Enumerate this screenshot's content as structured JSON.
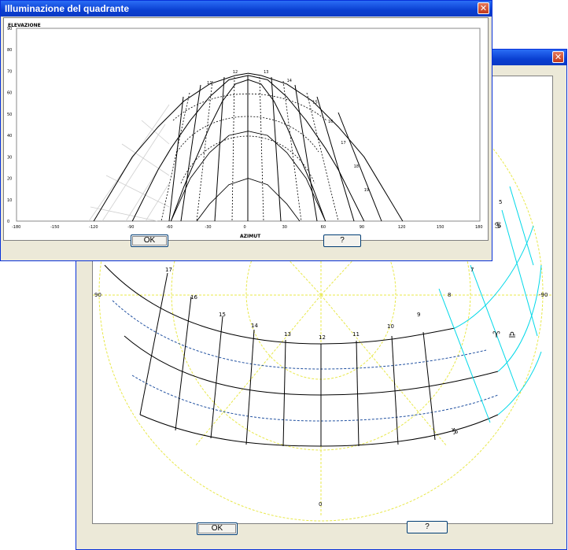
{
  "back_window": {
    "title": "",
    "close_label": "✕",
    "ok_label": "OK",
    "help_label": "?",
    "labels": {
      "left_90": "90",
      "right_90": "-90",
      "bottom_0": "0"
    },
    "hours_upper": [
      "17",
      "16",
      "15",
      "14",
      "13",
      "12",
      "11",
      "10",
      "9",
      "8",
      "7"
    ],
    "hours_right": [
      "5",
      "6"
    ],
    "zodiac_signs": [
      "♈",
      "♎",
      "♑",
      "♋"
    ],
    "colors": {
      "grid_black": "#000000",
      "cyan": "#00d8e8",
      "yellow": "#e8e84a",
      "blue_dashed": "#2050a0"
    }
  },
  "front_window": {
    "title": "Illuminazione del quadrante",
    "close_label": "✕",
    "ok_label": "OK",
    "help_label": "?"
  },
  "chart_data": {
    "type": "line",
    "title": "",
    "xlabel": "AZIMUT",
    "ylabel": "ELEVAZIONE",
    "xlim": [
      -180,
      180
    ],
    "ylim": [
      0,
      90
    ],
    "xticks": [
      -180,
      -150,
      -120,
      -90,
      -60,
      -30,
      0,
      30,
      60,
      90,
      120,
      150,
      180
    ],
    "yticks": [
      0,
      10,
      20,
      30,
      40,
      50,
      60,
      70,
      80,
      90
    ],
    "hour_labels": [
      {
        "text": "11",
        "az": -32,
        "el": 64
      },
      {
        "text": "12",
        "az": -12,
        "el": 69
      },
      {
        "text": "13",
        "az": 12,
        "el": 69
      },
      {
        "text": "14",
        "az": 30,
        "el": 65
      },
      {
        "text": "15",
        "az": 50,
        "el": 55
      },
      {
        "text": "16",
        "az": 62,
        "el": 46
      },
      {
        "text": "17",
        "az": 72,
        "el": 36
      },
      {
        "text": "18",
        "az": 82,
        "el": 25
      },
      {
        "text": "19",
        "az": 90,
        "el": 14
      }
    ],
    "series": [
      {
        "values": [
          [
            -60,
            0
          ],
          [
            -50,
            16
          ],
          [
            -40,
            30
          ],
          [
            -30,
            44
          ],
          [
            -20,
            56
          ],
          [
            -10,
            64
          ],
          [
            0,
            66
          ],
          [
            10,
            64
          ],
          [
            20,
            56
          ],
          [
            30,
            44
          ],
          [
            40,
            30
          ],
          [
            50,
            16
          ],
          [
            60,
            0
          ]
        ]
      },
      {
        "values": [
          [
            -90,
            0
          ],
          [
            -80,
            12
          ],
          [
            -70,
            24
          ],
          [
            -60,
            34
          ],
          [
            -45,
            47
          ],
          [
            -30,
            58
          ],
          [
            -15,
            66
          ],
          [
            0,
            68
          ],
          [
            15,
            66
          ],
          [
            30,
            58
          ],
          [
            45,
            47
          ],
          [
            60,
            34
          ],
          [
            70,
            24
          ],
          [
            80,
            12
          ],
          [
            90,
            0
          ]
        ]
      },
      {
        "values": [
          [
            -120,
            0
          ],
          [
            -110,
            10
          ],
          [
            -100,
            20
          ],
          [
            -90,
            30
          ],
          [
            -70,
            44
          ],
          [
            -50,
            56
          ],
          [
            -30,
            64
          ],
          [
            -10,
            68
          ],
          [
            0,
            69
          ],
          [
            10,
            68
          ],
          [
            30,
            64
          ],
          [
            50,
            56
          ],
          [
            70,
            44
          ],
          [
            90,
            30
          ],
          [
            100,
            20
          ],
          [
            110,
            10
          ],
          [
            120,
            0
          ]
        ]
      },
      {
        "values": [
          [
            -60,
            0
          ],
          [
            -45,
            20
          ],
          [
            -30,
            32
          ],
          [
            -15,
            40
          ],
          [
            0,
            42
          ],
          [
            15,
            40
          ],
          [
            30,
            32
          ],
          [
            45,
            20
          ],
          [
            60,
            0
          ]
        ]
      },
      {
        "values": [
          [
            -40,
            0
          ],
          [
            -30,
            8
          ],
          [
            -15,
            17
          ],
          [
            0,
            20
          ],
          [
            15,
            17
          ],
          [
            30,
            8
          ],
          [
            40,
            0
          ]
        ]
      }
    ]
  }
}
